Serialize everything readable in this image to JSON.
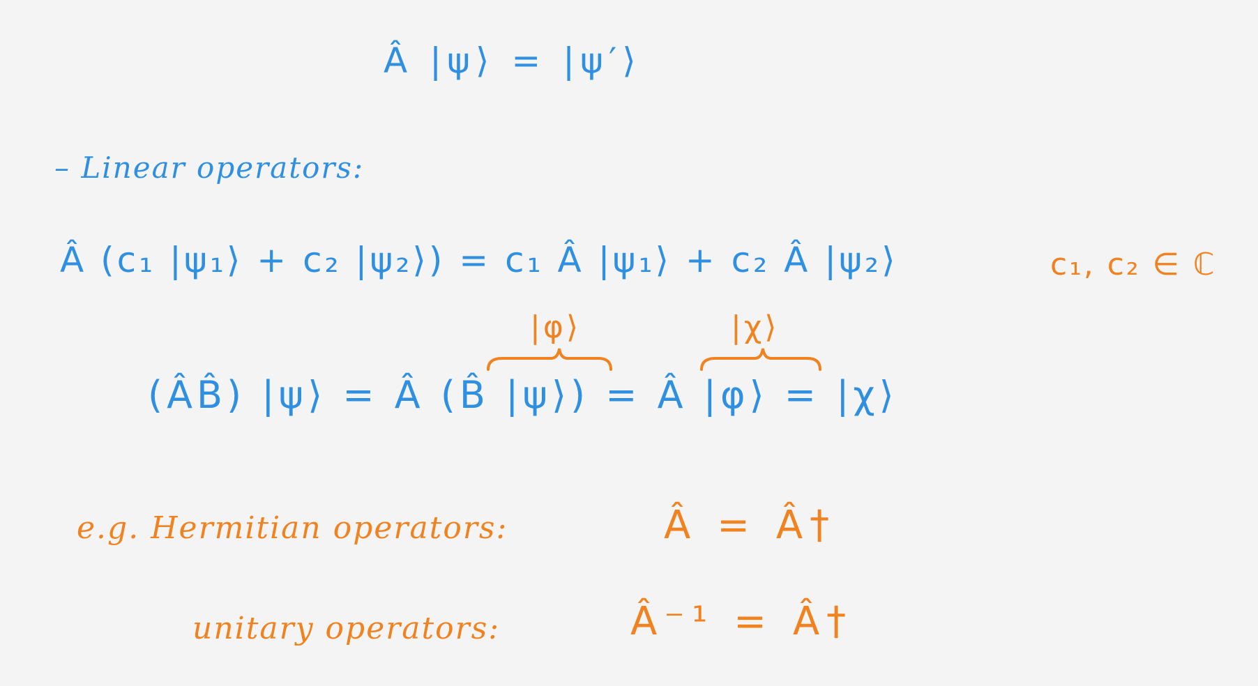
{
  "colors": {
    "background": "#f4f4f5",
    "primary_ink": "#2f8fe0",
    "accent_ink": "#f0821f"
  },
  "notes": {
    "operator_action": "Â |ψ⟩ = |ψ′⟩",
    "linear_heading": "– Linear operators:",
    "linearity_equation": "Â (c₁ |ψ₁⟩ + c₂ |ψ₂⟩) = c₁ Â |ψ₁⟩ + c₂ Â |ψ₂⟩",
    "coefficient_domain": "c₁, c₂ ∈ ℂ",
    "brace_label_phi": "|φ⟩",
    "brace_label_chi": "|χ⟩",
    "composition_equation": "(ÂB̂) |ψ⟩ = Â (B̂ |ψ⟩) = Â |φ⟩ = |χ⟩",
    "hermitian_label": "e.g. Hermitian operators:",
    "hermitian_equation": "Â = Â†",
    "unitary_label": "unitary operators:",
    "unitary_equation": "Â⁻¹ = Â†"
  }
}
